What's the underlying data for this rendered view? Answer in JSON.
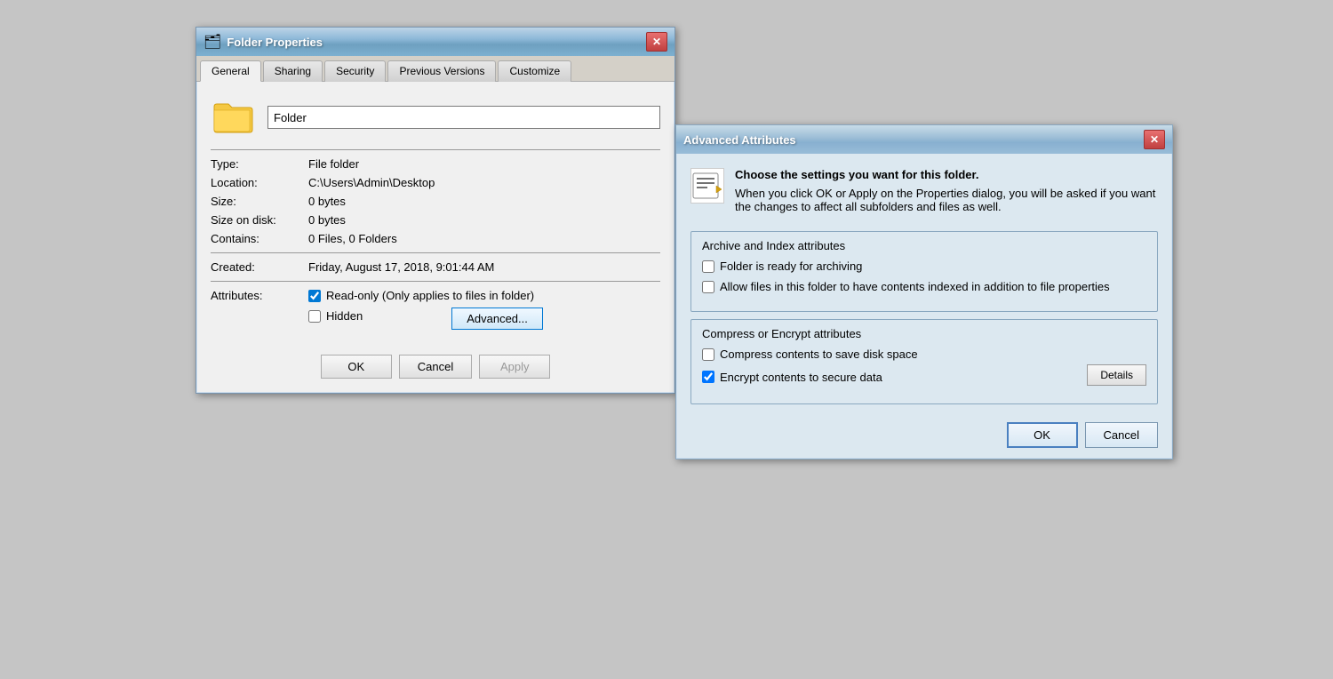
{
  "folderProps": {
    "titleBarText": "Folder Properties",
    "titleBarIcon": "🗂",
    "tabs": [
      {
        "label": "General",
        "active": true
      },
      {
        "label": "Sharing",
        "active": false
      },
      {
        "label": "Security",
        "active": false
      },
      {
        "label": "Previous Versions",
        "active": false
      },
      {
        "label": "Customize",
        "active": false
      }
    ],
    "folderName": "Folder",
    "type_label": "Type:",
    "type_value": "File folder",
    "location_label": "Location:",
    "location_value": "C:\\Users\\Admin\\Desktop",
    "size_label": "Size:",
    "size_value": "0 bytes",
    "sizeondisk_label": "Size on disk:",
    "sizeondisk_value": "0 bytes",
    "contains_label": "Contains:",
    "contains_value": "0 Files, 0 Folders",
    "created_label": "Created:",
    "created_value": "Friday, August 17, 2018, 9:01:44 AM",
    "attributes_label": "Attributes:",
    "readonly_label": "Read-only (Only applies to files in folder)",
    "hidden_label": "Hidden",
    "advanced_label": "Advanced...",
    "ok_label": "OK",
    "cancel_label": "Cancel",
    "apply_label": "Apply"
  },
  "advancedAttrs": {
    "titleBarText": "Advanced Attributes",
    "desc_line1": "Choose the settings you want for this folder.",
    "desc_line2": "When you click OK or Apply on the Properties dialog, you will be asked if you want the changes to affect all subfolders and files as well.",
    "archive_section_title": "Archive and Index attributes",
    "archive_checkbox": "Folder is ready for archiving",
    "index_checkbox": "Allow files in this folder to have contents indexed in addition to file properties",
    "compress_section_title": "Compress or Encrypt attributes",
    "compress_checkbox": "Compress contents to save disk space",
    "encrypt_checkbox": "Encrypt contents to secure data",
    "details_label": "Details",
    "ok_label": "OK",
    "cancel_label": "Cancel"
  }
}
